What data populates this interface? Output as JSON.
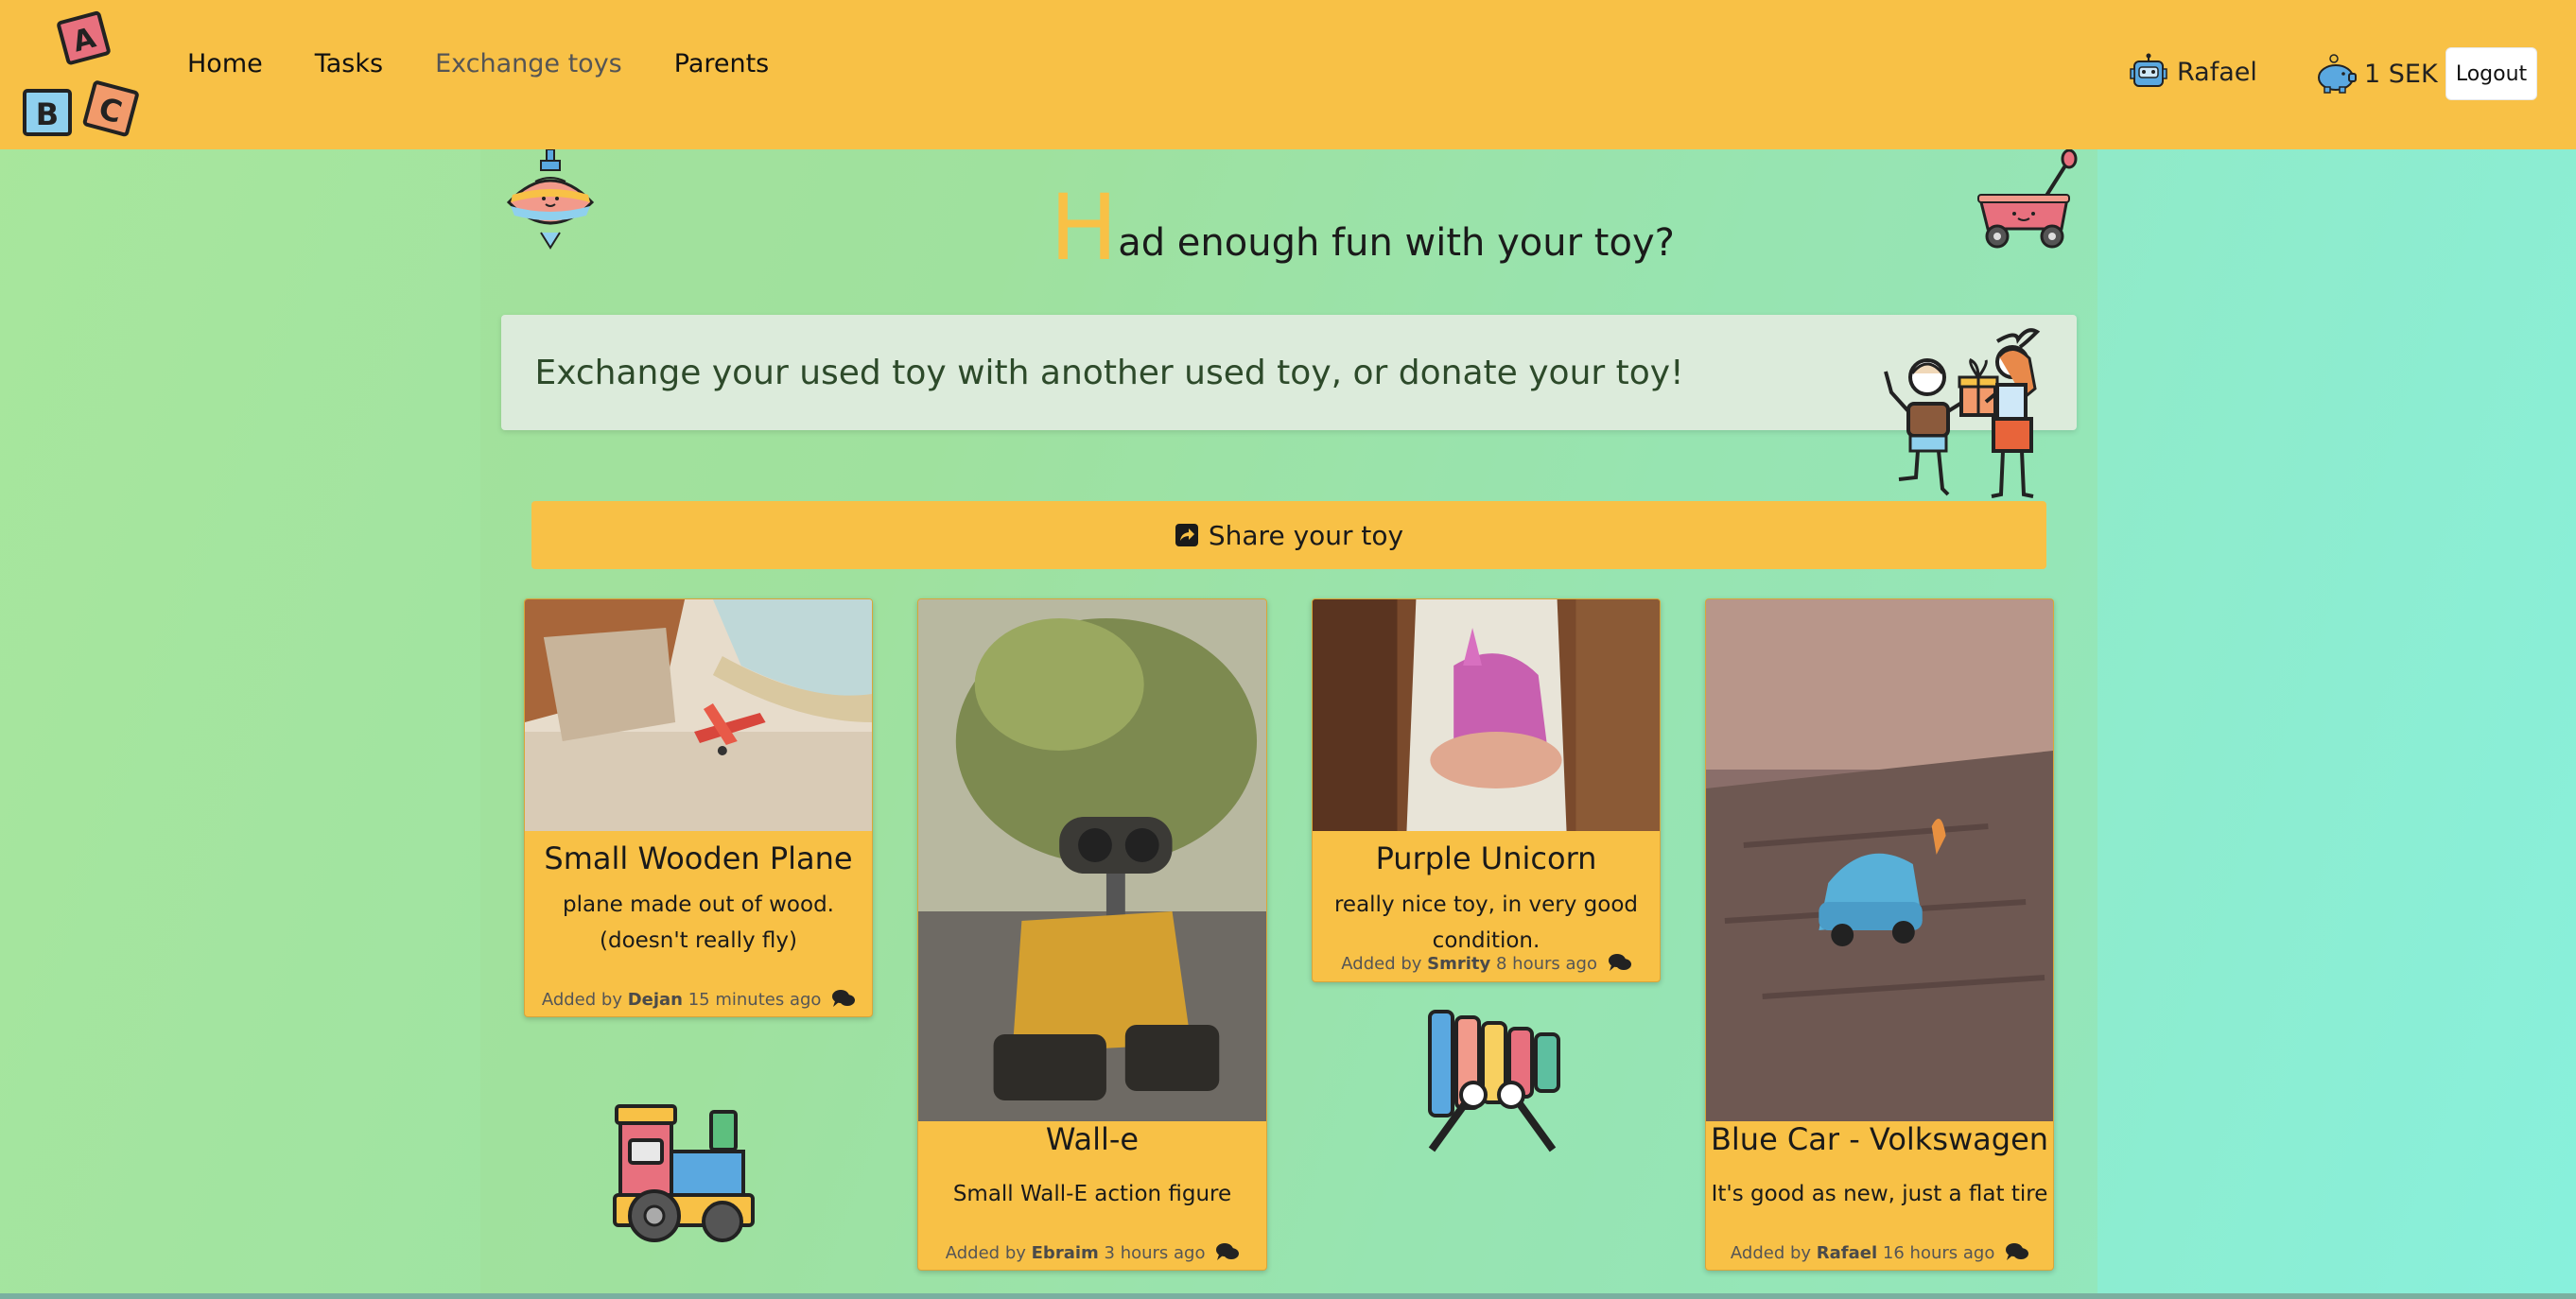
{
  "nav": {
    "links": [
      "Home",
      "Tasks",
      "Exchange toys",
      "Parents"
    ],
    "user_name": "Rafael",
    "balance": "1 SEK",
    "logout_label": "Logout",
    "logo_letters": [
      "A",
      "B",
      "C"
    ]
  },
  "hero": {
    "title_initial": "H",
    "title_rest": "ad enough fun with your toy?"
  },
  "banner": {
    "text": "Exchange your used toy with another used toy, or donate your toy!"
  },
  "share_button": {
    "label": "Share your toy",
    "icon": "share-icon"
  },
  "cards": [
    {
      "title": "Small Wooden Plane",
      "description": "plane made out of wood. (doesn't really fly)",
      "added_prefix": "Added by",
      "author": "Dejan",
      "time": "15 minutes ago",
      "image": "toy-plane-photo"
    },
    {
      "title": "Wall-e",
      "description": "Small Wall-E action figure",
      "added_prefix": "Added by",
      "author": "Ebraim",
      "time": "3 hours ago",
      "image": "wall-e-photo"
    },
    {
      "title": "Purple Unicorn",
      "description": "really nice toy, in very good condition.",
      "added_prefix": "Added by",
      "author": "Smrity",
      "time": "8 hours ago",
      "image": "unicorn-photo"
    },
    {
      "title": "Blue Car - Volkswagen",
      "description": "It's good as new, just a flat tire",
      "added_prefix": "Added by",
      "author": "Rafael",
      "time": "16 hours ago",
      "image": "blue-car-photo"
    }
  ],
  "colors": {
    "nav_bg": "#f8c146",
    "card_bg": "#f8c146",
    "accent": "#f8c146",
    "banner_bg": "#dcebdb"
  }
}
